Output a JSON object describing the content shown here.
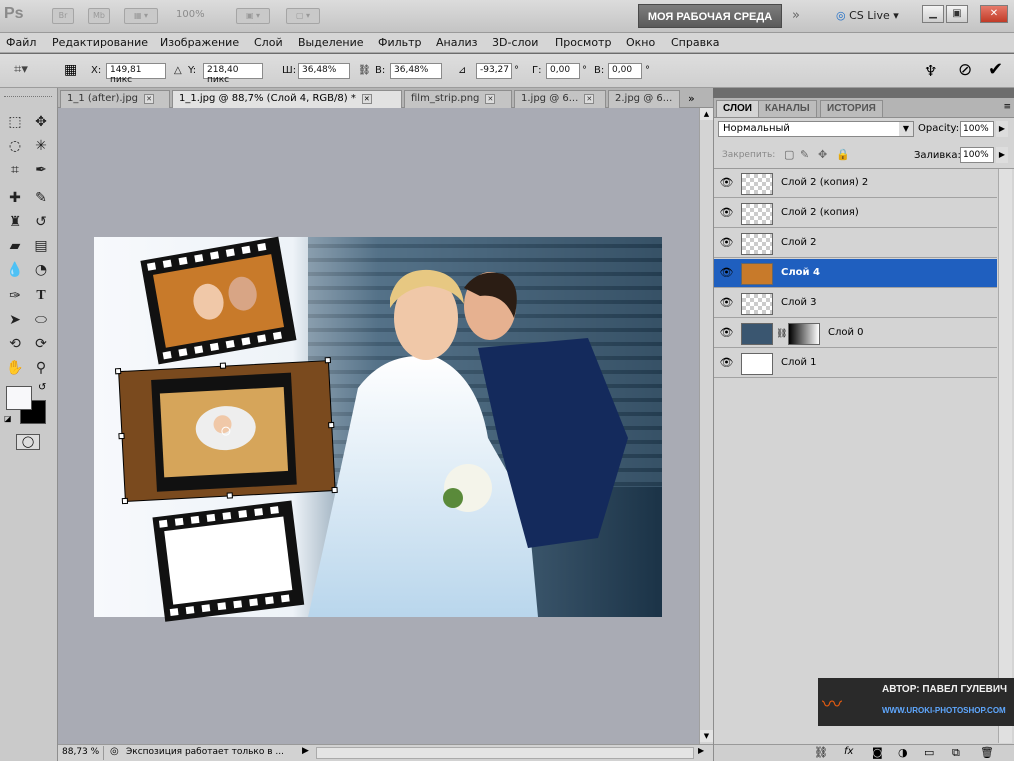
{
  "app": {
    "logo": "Ps",
    "bridge": "Br",
    "minibridge": "Mb",
    "zoom": "100%",
    "workspace": "МОЯ РАБОЧАЯ СРЕДА",
    "cslive": "CS Live",
    "arrows": "»"
  },
  "menu": [
    "Файл",
    "Редактирование",
    "Изображение",
    "Слой",
    "Выделение",
    "Фильтр",
    "Анализ",
    "3D-слои",
    "Просмотр",
    "Окно",
    "Справка"
  ],
  "options": {
    "x_label": "X:",
    "x_value": "149,81 пикс",
    "y_label": "Y:",
    "y_value": "218,40 пикс",
    "w_label": "Ш:",
    "w_value": "36,48%",
    "h_label": "В:",
    "h_value": "36,48%",
    "angle_value": "-93,27",
    "deg": "°",
    "g_label": "Г:",
    "g_value": "0,00",
    "v_label": "В:",
    "v_value": "0,00"
  },
  "tabs": [
    {
      "label": "1_1 (after).jpg"
    },
    {
      "label": "1_1.jpg @ 88,7% (Слой 4, RGB/8) *"
    },
    {
      "label": "film_strip.png"
    },
    {
      "label": "1.jpg @ 6..."
    },
    {
      "label": "2.jpg @ 6..."
    }
  ],
  "status": {
    "zoom": "88,73 %",
    "text": "Экспозиция работает только в ..."
  },
  "panel": {
    "tabs": [
      "СЛОИ",
      "КАНАЛЫ",
      "ИСТОРИЯ"
    ],
    "blend_mode": "Нормальный",
    "opacity_label": "Opacity:",
    "opacity_value": "100%",
    "lock_label": "Закрепить:",
    "fill_label": "Заливка:",
    "fill_value": "100%",
    "layers": [
      {
        "name": "Слой 2 (копия) 2"
      },
      {
        "name": "Слой 2 (копия)"
      },
      {
        "name": "Слой 2"
      },
      {
        "name": "Слой 4"
      },
      {
        "name": "Слой 3"
      },
      {
        "name": "Слой 0"
      },
      {
        "name": "Слой 1"
      }
    ]
  },
  "watermark": {
    "author": "АВТОР: ПАВЕЛ ГУЛЕВИЧ",
    "site": "WWW.UROKI-PHOTOSHOP.COM"
  },
  "colors": {
    "selected_layer": "#1f5fbf",
    "workspace_bg": "#a9abb4"
  }
}
